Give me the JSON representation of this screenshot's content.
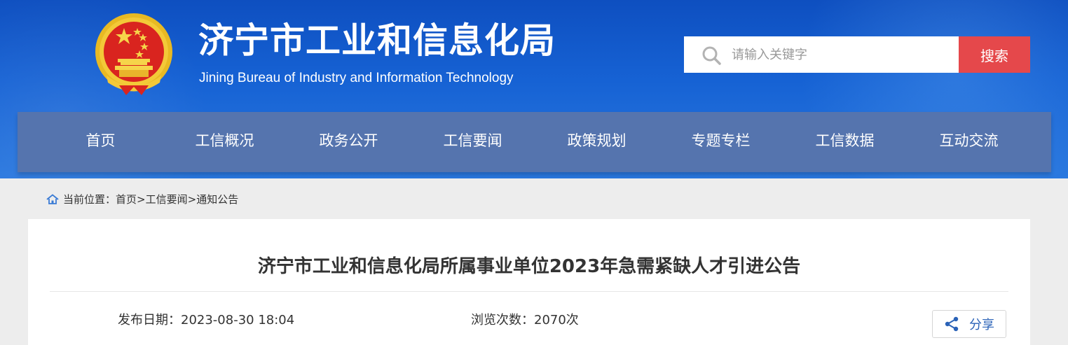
{
  "header": {
    "title_cn": "济宁市工业和信息化局",
    "title_en": "Jining Bureau of Industry and Information Technology",
    "emblem_icon": "national-emblem-icon"
  },
  "search": {
    "placeholder": "请输入关键字",
    "button_label": "搜索",
    "icon": "search-icon"
  },
  "nav": {
    "items": [
      {
        "label": "首页"
      },
      {
        "label": "工信概况"
      },
      {
        "label": "政务公开"
      },
      {
        "label": "工信要闻"
      },
      {
        "label": "政策规划"
      },
      {
        "label": "专题专栏"
      },
      {
        "label": "工信数据"
      },
      {
        "label": "互动交流"
      }
    ]
  },
  "breadcrumb": {
    "prefix": "当前位置：",
    "items": [
      "首页",
      "工信要闻",
      "通知公告"
    ],
    "separator": ">"
  },
  "article": {
    "title": "济宁市工业和信息化局所属事业单位2023年急需紧缺人才引进公告",
    "publish_label": "发布日期：",
    "publish_date": "2023-08-30 18:04",
    "views_label": "浏览次数：",
    "views_count": "2070次",
    "share_label": "分享"
  },
  "colors": {
    "header_blue": "#1662d4",
    "nav_bg": "#5574ae",
    "search_button": "#e5484b",
    "share_text": "#2a62b7"
  }
}
